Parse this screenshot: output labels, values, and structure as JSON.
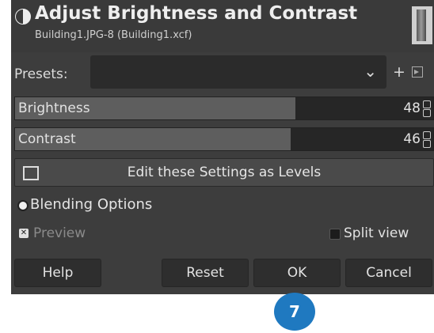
{
  "header": {
    "title": "Adjust Brightness and Contrast",
    "subtitle": "Building1.JPG-8 (Building1.xcf)",
    "icon": "brightness-contrast-icon",
    "thumbnail": "building-thumbnail"
  },
  "presets": {
    "label": "Presets:",
    "value": "",
    "add_icon": "+",
    "menu_icon": "menu-icon"
  },
  "brightness": {
    "label": "Brightness",
    "value": "48"
  },
  "contrast": {
    "label": "Contrast",
    "value": "46"
  },
  "levels_button": {
    "label": "Edit these Settings as Levels"
  },
  "blending": {
    "label": "Blending Options"
  },
  "preview": {
    "label": "Preview",
    "checked": true
  },
  "split_view": {
    "label": "Split view",
    "checked": false
  },
  "buttons": {
    "help": "Help",
    "reset": "Reset",
    "ok": "OK",
    "cancel": "Cancel"
  },
  "step_badge": {
    "number": "7",
    "color": "#1f79c0"
  }
}
